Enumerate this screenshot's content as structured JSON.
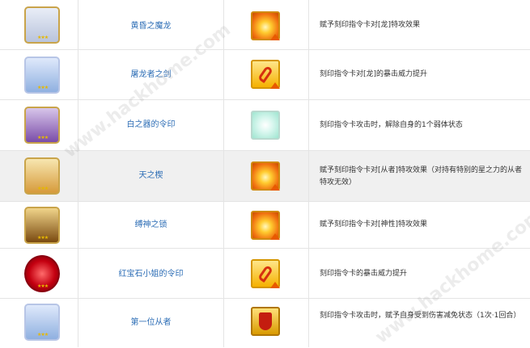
{
  "rows": [
    {
      "name": "黄昏之魔龙",
      "icon": "dragon-portrait-icon",
      "effect_icon": "burst-attack-icon",
      "desc": "赋予刻印指令卡对[龙]特攻效果"
    },
    {
      "name": "屠龙者之剑",
      "icon": "dragonslayer-portrait-icon",
      "effect_icon": "crit-up-icon",
      "desc": "刻印指令卡对[龙]的暴击威力提升"
    },
    {
      "name": "白之器的令印",
      "icon": "purple-seal-portrait-icon",
      "effect_icon": "debuff-remove-icon",
      "desc": "刻印指令卡攻击时，解除自身的1个弱体状态"
    },
    {
      "name": "天之楔",
      "icon": "golden-servant-portrait-icon",
      "effect_icon": "burst-attack-icon",
      "desc": "赋予刻印指令卡对[从者]特攻效果（对持有特别的星之力的从者特攻无效）"
    },
    {
      "name": "缚神之锁",
      "icon": "chain-portrait-icon",
      "effect_icon": "burst-attack-icon",
      "desc": "赋予刻印指令卡对[神性]特攻效果"
    },
    {
      "name": "红宝石小姐的令印",
      "icon": "ruby-seal-portrait-icon",
      "effect_icon": "crit-up-icon",
      "desc": "刻印指令卡的暴击威力提升"
    },
    {
      "name": "第一位从者",
      "icon": "first-servant-portrait-icon",
      "effect_icon": "damage-reduction-icon",
      "desc": "刻印指令卡攻击时，赋予自身受到伤害减免状态（1次·1回合）"
    }
  ],
  "watermark": "www.hackhome.com"
}
